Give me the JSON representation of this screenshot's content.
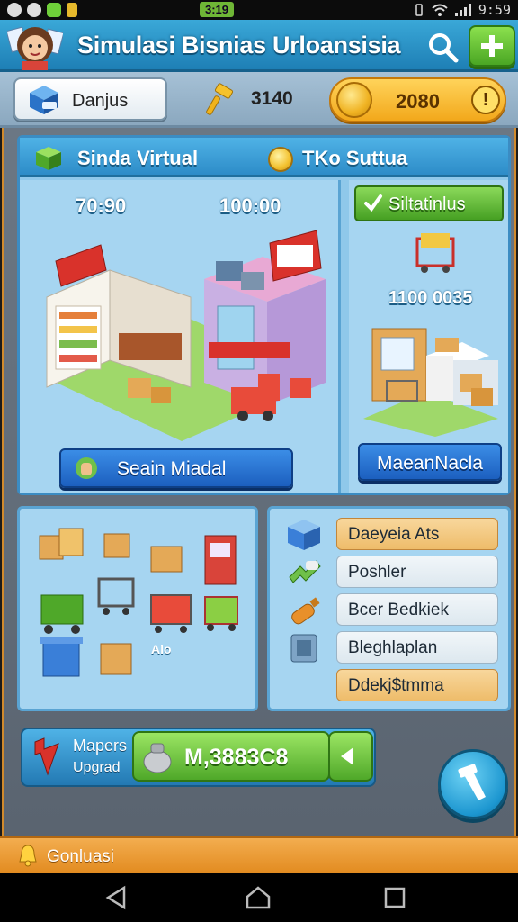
{
  "status_bar": {
    "center_label": "3:19",
    "time": "9:59",
    "icons": [
      "app-icon-a",
      "circle-icon",
      "check-icon",
      "battery-icon",
      "vibrate-icon",
      "wifi-icon",
      "signal-icon"
    ]
  },
  "header": {
    "title": "Simulasi Bisnias Urloansisia",
    "search_icon": "search-icon",
    "add_icon": "add-icon"
  },
  "resources": {
    "player_label": "Danjus",
    "gems": "3140",
    "coins": "2080",
    "info_label": "!"
  },
  "tabs": {
    "tab1": "Sinda Virtual",
    "tab2": "TKo Suttua"
  },
  "stores": {
    "store_a_value": "70:90",
    "store_b_value": "100:00",
    "build_button": "Seain Miadal"
  },
  "side_panel": {
    "top_button": "Siltatinlus",
    "value": "1100 0035",
    "bottom_button": "MaeanNacla"
  },
  "inventory": {
    "note": "Alo",
    "items": [
      "box-icon",
      "box-icon",
      "box-icon",
      "fridge-icon",
      "cart-icon",
      "cart-icon",
      "cart-icon",
      "cart-icon",
      "bin-icon",
      "box-icon"
    ]
  },
  "actions": [
    {
      "label": "Daeyeia Ats",
      "icon": "package-icon",
      "style": "orange"
    },
    {
      "label": "Poshler",
      "icon": "hand-icon",
      "style": "plain"
    },
    {
      "label": "Bcer Bedkiek",
      "icon": "bottle-icon",
      "style": "plain"
    },
    {
      "label": "Bleghlaplan",
      "icon": "crate-icon",
      "style": "plain"
    },
    {
      "label": "Ddekj$tmma",
      "icon": "none",
      "style": "orange"
    }
  ],
  "upgrade": {
    "label_line1": "Mapers",
    "label_line2": "Upgrad",
    "money": "M,3883C8",
    "go_icon": "chevron-left-icon"
  },
  "footer": {
    "label": "Gonluasi"
  },
  "colors": {
    "header_blue": "#2d8cc8",
    "accent_green": "#4fa829",
    "coin_gold": "#f2a81b",
    "footer_orange": "#e28b20"
  }
}
